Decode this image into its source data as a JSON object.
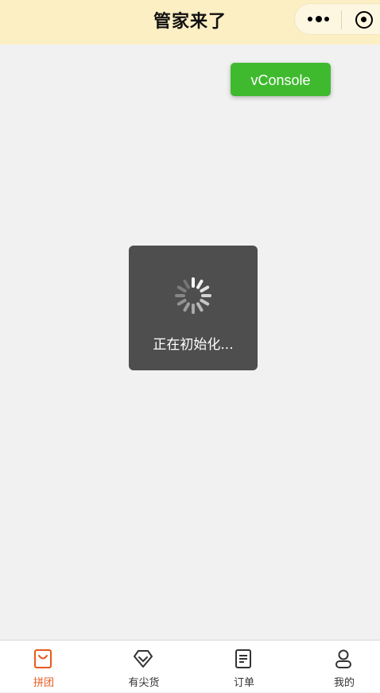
{
  "navbar": {
    "title": "管家来了",
    "capsule": {
      "more_icon": "more-dots-icon",
      "close_icon": "target-circle-icon"
    },
    "background": "#fcefc4"
  },
  "debug": {
    "vconsole_label": "vConsole",
    "color": "#3fba2f"
  },
  "toast": {
    "text": "正在初始化...",
    "icon": "loading-spinner-icon"
  },
  "tabbar": {
    "active_color": "#e85a1c",
    "items": [
      {
        "label": "拼团",
        "icon": "shopping-bag-icon",
        "active": true
      },
      {
        "label": "有尖货",
        "icon": "diamond-icon",
        "active": false
      },
      {
        "label": "订单",
        "icon": "document-list-icon",
        "active": false
      },
      {
        "label": "我的",
        "icon": "user-profile-icon",
        "active": false
      }
    ]
  }
}
